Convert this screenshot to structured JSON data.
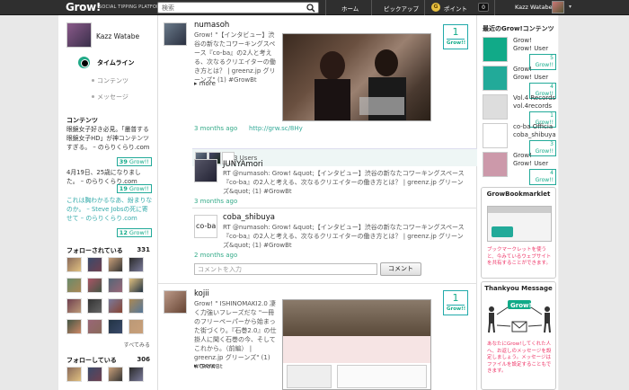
{
  "header": {
    "logo": "Grow!",
    "logo_sub": "SOCIAL TIPPING PLATFORM",
    "search_placeholder": "検索",
    "nav": [
      "ホーム",
      "ピックアップ",
      "ポイント"
    ],
    "coin_symbol": "G",
    "notification_count": "0",
    "user_name": "Kazz Watabe",
    "caret": "▾"
  },
  "left": {
    "user_name": "Kazz Watabe",
    "nav": [
      "タイムライン",
      "コンテンツ",
      "メッセージ"
    ],
    "contents_title": "コンテンツ",
    "contents": [
      {
        "text": "眼鏡女子好き必見。「叢普する眼鏡女子HD」が神コンテンツすぎる。 – のらりくらり.com",
        "badge_num": "39",
        "badge_label": "Grow!!",
        "muted": false
      },
      {
        "text": "4月19日、25歳になりました。 – のらりくらり.com",
        "badge_num": "19",
        "badge_label": "Grow!!",
        "muted": false
      },
      {
        "text": "これは胸わかるなあ、紛まりなのか。 – Steve Jobsの死に寄せて – のらりくらり.com",
        "badge_num": "12",
        "badge_label": "Grow!!",
        "muted": true
      }
    ],
    "followers_title": "フォローされている",
    "followers_count": "331",
    "see_all": "すべてみる",
    "following_title": "フォローしている",
    "following_count": "306"
  },
  "posts": [
    {
      "author": "numasoh",
      "text": "Grow! \"【インタビュー】渋谷の新なたコワーキングスペース『co-ba』の2人と考える、次なるクリエイターの働き方とは？ | greenz.jp グリーンズ\" (1) #GrowBt",
      "more": "▸ more",
      "count": "1",
      "count_label": "Grow!!",
      "time": "3 months ago",
      "link": "http://grw.sc/8Hy",
      "users": "3 Users"
    },
    {
      "author": "JUNYAmori",
      "text": "RT @numasoh: Grow! &quot;【インタビュー】渋谷の新なたコワーキングスペース『co-ba』の2人と考える、次なるクリエイターの働き方とは？ | greenz.jp グリーンズ&quot; (1) #GrowBt",
      "time": "3 months ago"
    },
    {
      "author": "coba_shibuya",
      "text": "RT @numasoh: Grow! &quot;【インタビュー】渋谷の新なたコワーキングスペース『co-ba』の2人と考える、次なるクリエイターの働き方とは？ | greenz.jp グリーンズ&quot; (1) #GrowBt",
      "time": "2 months ago",
      "comment_placeholder": "コメントを入力",
      "comment_button": "コメント"
    },
    {
      "author": "kojii",
      "text": "Grow! \" ISHINOMAKI2.0 凄く力強いフレーズだな \"一冊のフリーペーパーから始まった街づくり。『石巻2.0』の仕掛人に聞く石巻の今、そしてこれから。（前編） | greenz.jp グリーンズ\" (1) #GrowBt",
      "more": "▸ more",
      "count": "1",
      "count_label": "Grow!!"
    }
  ],
  "right": {
    "latest_title": "最近のGrow!コンテンツ",
    "latest": [
      {
        "name": "Grow!\nGrow! User",
        "num": "5",
        "label": "Grow!!"
      },
      {
        "name": "Grow!\nGrow! User",
        "num": "4",
        "label": "Grow!!"
      },
      {
        "name": "Vol.4 Records\nvol.4records",
        "num": "1",
        "label": "Grow!!"
      },
      {
        "name": "co-ba Officia\ncoba_shibuya",
        "num": "3",
        "label": "Grow!!"
      },
      {
        "name": "Grow!\nGrow! User",
        "num": "4",
        "label": "Grow!!"
      }
    ],
    "bookmarklet_title": "GrowBookmarklet",
    "bookmarklet_text": "ブックマークレットを使うと、今みているウェブサイトを共有することができます。",
    "thankyou_title": "Thankyou Message",
    "thankyou_text": "あなたにGrow!してくれた人へ、お返しのメッセージを設定しましょう。メッセージはファイルを設定することもできます。",
    "thankyou_logo": "Grow!"
  },
  "colors": {
    "accent": "#22aa88",
    "header": "#2f2f2f",
    "coin": "#e8c040"
  }
}
